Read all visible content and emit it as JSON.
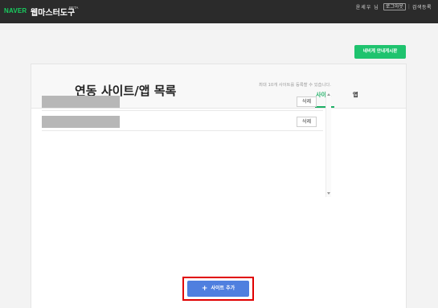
{
  "header": {
    "brand": "NAVER",
    "product": "웹마스터도구",
    "beta": "BETA",
    "user_name": "윤세우 님",
    "logout_label": "로그아웃",
    "separator": "|",
    "search_register": "검색등록"
  },
  "nav_button_label": "네비게 안내게시판",
  "page": {
    "title": "연동 사이트/앱 목록",
    "tabs": [
      {
        "label": "사이트",
        "active": true
      },
      {
        "label": "앱",
        "active": false
      }
    ],
    "limit_note": "최대 10개 사이트를 등록할 수 있습니다.",
    "rows": [
      {
        "delete_label": "삭제"
      },
      {
        "delete_label": "삭제"
      }
    ],
    "add_site_label": "사이트 추가",
    "add_icon": "+"
  },
  "colors": {
    "topbar": "#2b2b2b",
    "brand_green": "#19ce60",
    "tab_active": "#1eb066",
    "add_button": "#4f7fdf",
    "highlight": "#e00000"
  }
}
